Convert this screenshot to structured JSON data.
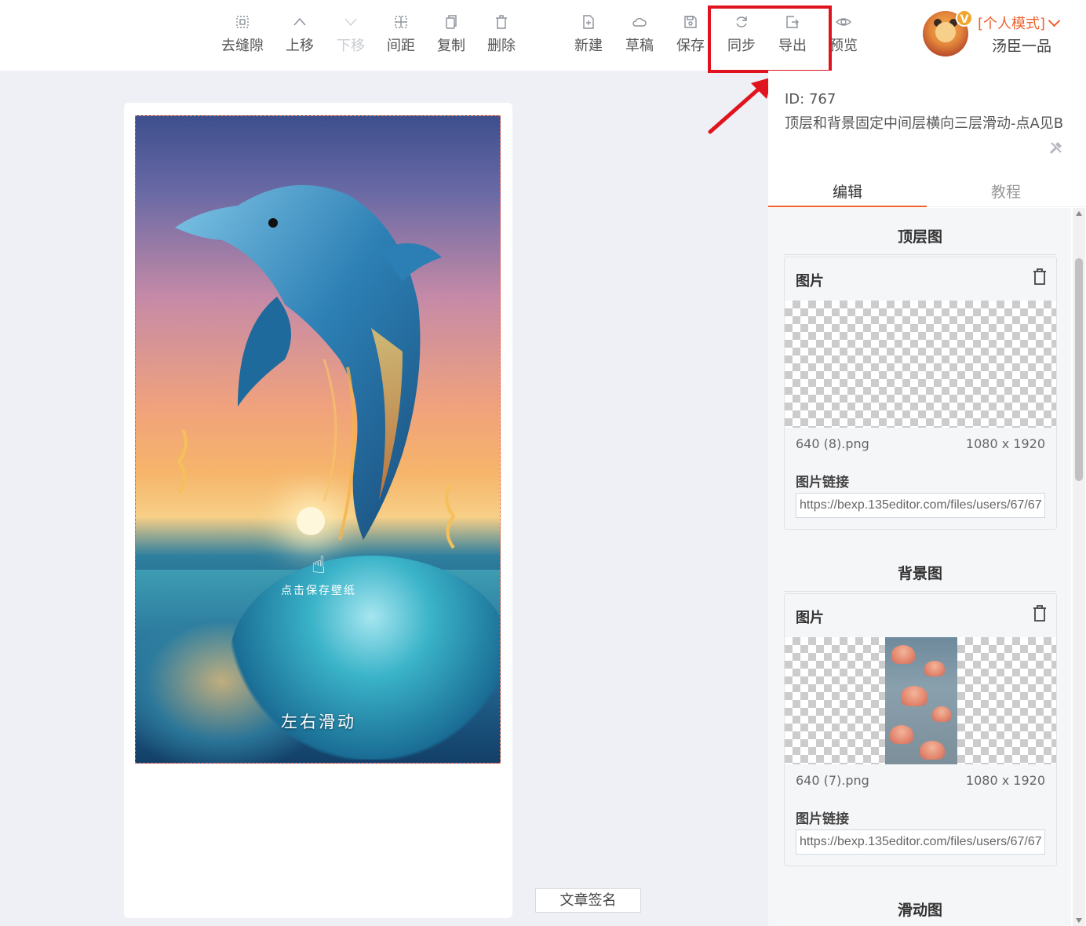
{
  "toolbar": {
    "items": [
      {
        "label": "去缝隙",
        "icon": "gap-icon"
      },
      {
        "label": "上移",
        "icon": "chevron-up-icon"
      },
      {
        "label": "下移",
        "icon": "chevron-down-icon"
      },
      {
        "label": "间距",
        "icon": "spacing-icon"
      },
      {
        "label": "复制",
        "icon": "copy-icon"
      },
      {
        "label": "删除",
        "icon": "trash-icon"
      },
      {
        "label": "新建",
        "icon": "new-file-icon"
      },
      {
        "label": "草稿",
        "icon": "cloud-icon"
      },
      {
        "label": "保存",
        "icon": "save-icon"
      },
      {
        "label": "同步",
        "icon": "sync-icon"
      },
      {
        "label": "导出",
        "icon": "export-icon"
      },
      {
        "label": "预览",
        "icon": "eye-icon"
      }
    ]
  },
  "user": {
    "badge": "V",
    "mode": "[个人模式]",
    "name": "汤臣一品"
  },
  "canvas": {
    "hint_text": "点击保存壁纸",
    "swipe_text": "左右滑动",
    "signature_button": "文章签名"
  },
  "panel": {
    "id_text": "ID: 767",
    "title": "顶层和背景固定中间层横向三层滑动-点A见B",
    "tabs": [
      "编辑",
      "教程"
    ],
    "sections": [
      {
        "title": "顶层图",
        "card_label": "图片",
        "file_name": "640 (8).png",
        "file_size": "1080 x 1920",
        "link_label": "图片链接",
        "link_value": "https://bexp.135editor.com/files/users/67/67"
      },
      {
        "title": "背景图",
        "card_label": "图片",
        "file_name": "640 (7).png",
        "file_size": "1080 x 1920",
        "link_label": "图片链接",
        "link_value": "https://bexp.135editor.com/files/users/67/67"
      },
      {
        "title": "滑动图"
      }
    ]
  },
  "colors": {
    "accent": "#f0612c",
    "highlight": "#e0141e"
  }
}
